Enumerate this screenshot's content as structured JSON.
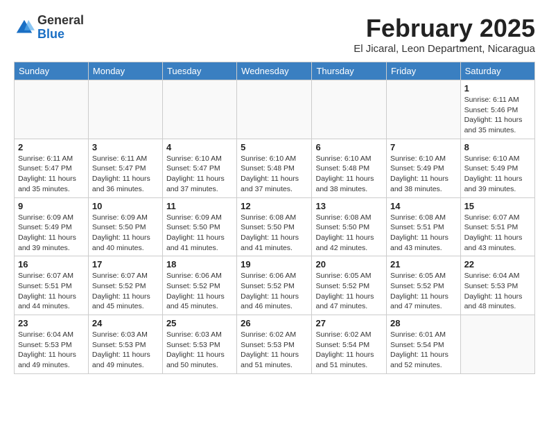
{
  "logo": {
    "general": "General",
    "blue": "Blue"
  },
  "header": {
    "month_year": "February 2025",
    "location": "El Jicaral, Leon Department, Nicaragua"
  },
  "days_of_week": [
    "Sunday",
    "Monday",
    "Tuesday",
    "Wednesday",
    "Thursday",
    "Friday",
    "Saturday"
  ],
  "weeks": [
    [
      {
        "day": "",
        "info": ""
      },
      {
        "day": "",
        "info": ""
      },
      {
        "day": "",
        "info": ""
      },
      {
        "day": "",
        "info": ""
      },
      {
        "day": "",
        "info": ""
      },
      {
        "day": "",
        "info": ""
      },
      {
        "day": "1",
        "info": "Sunrise: 6:11 AM\nSunset: 5:46 PM\nDaylight: 11 hours\nand 35 minutes."
      }
    ],
    [
      {
        "day": "2",
        "info": "Sunrise: 6:11 AM\nSunset: 5:47 PM\nDaylight: 11 hours\nand 35 minutes."
      },
      {
        "day": "3",
        "info": "Sunrise: 6:11 AM\nSunset: 5:47 PM\nDaylight: 11 hours\nand 36 minutes."
      },
      {
        "day": "4",
        "info": "Sunrise: 6:10 AM\nSunset: 5:47 PM\nDaylight: 11 hours\nand 37 minutes."
      },
      {
        "day": "5",
        "info": "Sunrise: 6:10 AM\nSunset: 5:48 PM\nDaylight: 11 hours\nand 37 minutes."
      },
      {
        "day": "6",
        "info": "Sunrise: 6:10 AM\nSunset: 5:48 PM\nDaylight: 11 hours\nand 38 minutes."
      },
      {
        "day": "7",
        "info": "Sunrise: 6:10 AM\nSunset: 5:49 PM\nDaylight: 11 hours\nand 38 minutes."
      },
      {
        "day": "8",
        "info": "Sunrise: 6:10 AM\nSunset: 5:49 PM\nDaylight: 11 hours\nand 39 minutes."
      }
    ],
    [
      {
        "day": "9",
        "info": "Sunrise: 6:09 AM\nSunset: 5:49 PM\nDaylight: 11 hours\nand 39 minutes."
      },
      {
        "day": "10",
        "info": "Sunrise: 6:09 AM\nSunset: 5:50 PM\nDaylight: 11 hours\nand 40 minutes."
      },
      {
        "day": "11",
        "info": "Sunrise: 6:09 AM\nSunset: 5:50 PM\nDaylight: 11 hours\nand 41 minutes."
      },
      {
        "day": "12",
        "info": "Sunrise: 6:08 AM\nSunset: 5:50 PM\nDaylight: 11 hours\nand 41 minutes."
      },
      {
        "day": "13",
        "info": "Sunrise: 6:08 AM\nSunset: 5:50 PM\nDaylight: 11 hours\nand 42 minutes."
      },
      {
        "day": "14",
        "info": "Sunrise: 6:08 AM\nSunset: 5:51 PM\nDaylight: 11 hours\nand 43 minutes."
      },
      {
        "day": "15",
        "info": "Sunrise: 6:07 AM\nSunset: 5:51 PM\nDaylight: 11 hours\nand 43 minutes."
      }
    ],
    [
      {
        "day": "16",
        "info": "Sunrise: 6:07 AM\nSunset: 5:51 PM\nDaylight: 11 hours\nand 44 minutes."
      },
      {
        "day": "17",
        "info": "Sunrise: 6:07 AM\nSunset: 5:52 PM\nDaylight: 11 hours\nand 45 minutes."
      },
      {
        "day": "18",
        "info": "Sunrise: 6:06 AM\nSunset: 5:52 PM\nDaylight: 11 hours\nand 45 minutes."
      },
      {
        "day": "19",
        "info": "Sunrise: 6:06 AM\nSunset: 5:52 PM\nDaylight: 11 hours\nand 46 minutes."
      },
      {
        "day": "20",
        "info": "Sunrise: 6:05 AM\nSunset: 5:52 PM\nDaylight: 11 hours\nand 47 minutes."
      },
      {
        "day": "21",
        "info": "Sunrise: 6:05 AM\nSunset: 5:52 PM\nDaylight: 11 hours\nand 47 minutes."
      },
      {
        "day": "22",
        "info": "Sunrise: 6:04 AM\nSunset: 5:53 PM\nDaylight: 11 hours\nand 48 minutes."
      }
    ],
    [
      {
        "day": "23",
        "info": "Sunrise: 6:04 AM\nSunset: 5:53 PM\nDaylight: 11 hours\nand 49 minutes."
      },
      {
        "day": "24",
        "info": "Sunrise: 6:03 AM\nSunset: 5:53 PM\nDaylight: 11 hours\nand 49 minutes."
      },
      {
        "day": "25",
        "info": "Sunrise: 6:03 AM\nSunset: 5:53 PM\nDaylight: 11 hours\nand 50 minutes."
      },
      {
        "day": "26",
        "info": "Sunrise: 6:02 AM\nSunset: 5:53 PM\nDaylight: 11 hours\nand 51 minutes."
      },
      {
        "day": "27",
        "info": "Sunrise: 6:02 AM\nSunset: 5:54 PM\nDaylight: 11 hours\nand 51 minutes."
      },
      {
        "day": "28",
        "info": "Sunrise: 6:01 AM\nSunset: 5:54 PM\nDaylight: 11 hours\nand 52 minutes."
      },
      {
        "day": "",
        "info": ""
      }
    ]
  ]
}
